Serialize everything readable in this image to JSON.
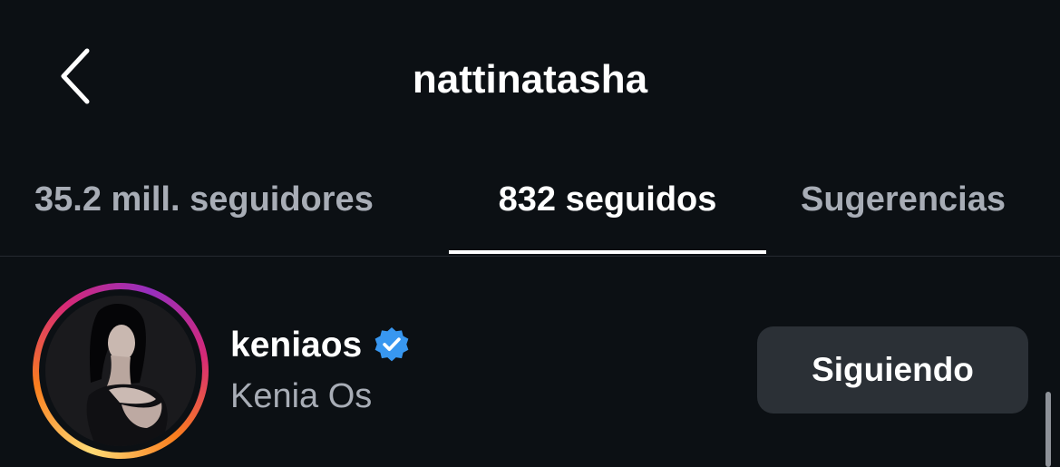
{
  "header": {
    "back_icon": "chevron-left-icon",
    "title": "nattinatasha"
  },
  "tabs": [
    {
      "label": "35.2 mill. seguidores",
      "active": false
    },
    {
      "label": "832 seguidos",
      "active": true
    },
    {
      "label": "Sugerencias",
      "active": false
    }
  ],
  "list": [
    {
      "username": "keniaos",
      "verified": true,
      "verified_icon": "verified-badge-icon",
      "full_name": "Kenia Os",
      "button_label": "Siguiendo",
      "has_story_ring": true
    }
  ],
  "colors": {
    "background": "#0c1014",
    "text_primary": "#ffffff",
    "text_secondary": "#a8adb6",
    "button_bg": "#2b3036",
    "verified_blue": "#3897f0"
  }
}
